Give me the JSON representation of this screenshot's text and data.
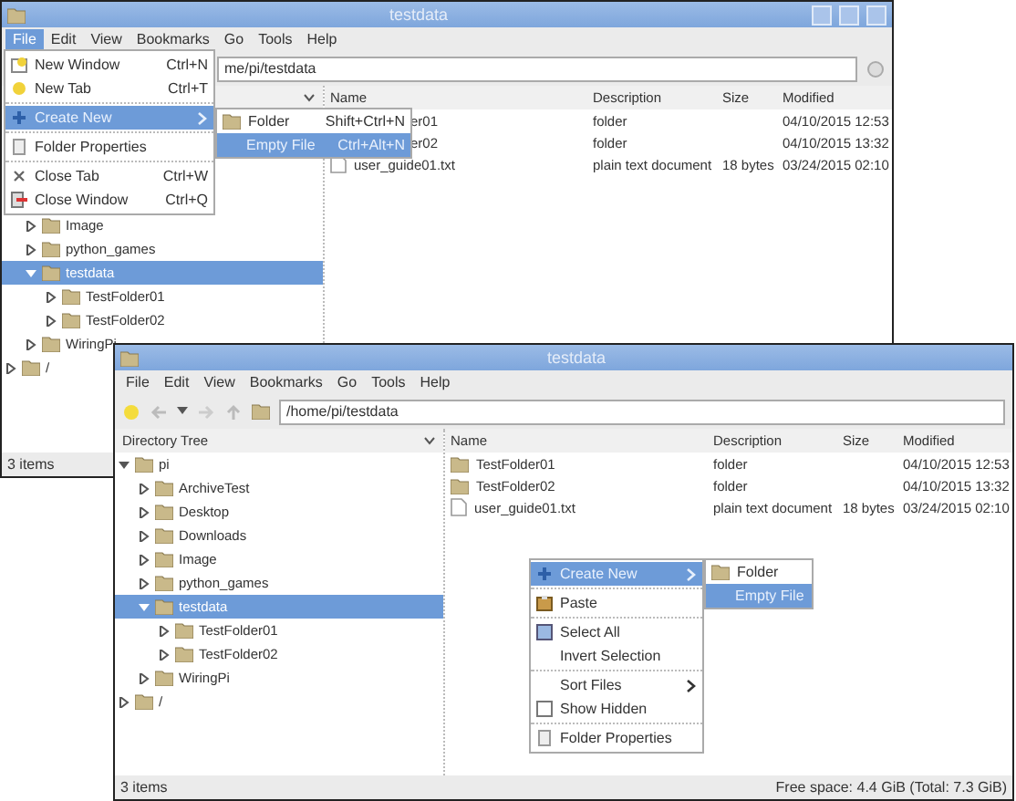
{
  "windows": [
    {
      "title": "testdata",
      "menu_bar": [
        {
          "label": "File",
          "selected": true
        },
        {
          "label": "Edit",
          "selected": false
        },
        {
          "label": "View",
          "selected": false
        },
        {
          "label": "Bookmarks",
          "selected": false
        },
        {
          "label": "Go",
          "selected": false
        },
        {
          "label": "Tools",
          "selected": false
        },
        {
          "label": "Help",
          "selected": false
        }
      ],
      "path": "me/pi/testdata",
      "tree": [
        {
          "children": [
            {
              "label": "Image",
              "expanded": false,
              "selected": false
            },
            {
              "label": "python_games",
              "expanded": false,
              "selected": false
            },
            {
              "label": "testdata",
              "expanded": true,
              "selected": true,
              "children": [
                {
                  "label": "TestFolder01",
                  "expanded": false,
                  "selected": false
                },
                {
                  "label": "TestFolder02",
                  "expanded": false,
                  "selected": false
                }
              ]
            },
            {
              "label": "WiringPi",
              "expanded": false,
              "selected": false
            }
          ]
        },
        {
          "label": "/",
          "expanded": false,
          "selected": false
        }
      ],
      "columns": [
        "Name",
        "Description",
        "Size",
        "Modified"
      ],
      "rows": [
        {
          "name": "er01",
          "description": "folder",
          "modified": "04/10/2015 12:53"
        },
        {
          "name": "er02",
          "description": "folder",
          "modified": "04/10/2015 13:32"
        },
        {
          "kind": "text",
          "name": "user_guide01.txt",
          "description": "plain text document",
          "size": "18 bytes",
          "modified": "03/24/2015 02:10"
        }
      ],
      "status": "3 items",
      "menu": {
        "groups": [
          [
            {
              "kind": "window",
              "label": "New Window",
              "shortcut": "Ctrl+N",
              "selected": false
            },
            {
              "kind": "tab",
              "label": "New Tab",
              "shortcut": "Ctrl+T",
              "selected": false
            }
          ],
          [
            {
              "kind": "create",
              "label": "Create New",
              "submenu": true,
              "selected": true
            }
          ],
          [
            {
              "kind": "properties",
              "label": "Folder Properties",
              "selected": false
            }
          ],
          [
            {
              "kind": "closetab",
              "label": "Close Tab",
              "shortcut": "Ctrl+W",
              "selected": false
            },
            {
              "kind": "closewindow",
              "label": "Close Window",
              "shortcut": "Ctrl+Q",
              "selected": false
            }
          ]
        ]
      },
      "submenu": {
        "items": [
          {
            "kind": "folder",
            "label": "Folder",
            "shortcut": "Shift+Ctrl+N",
            "selected": false
          },
          {
            "kind": "plain",
            "label": "Empty File",
            "shortcut": "Ctrl+Alt+N",
            "selected": true
          }
        ]
      }
    },
    {
      "title": "testdata",
      "menu_bar": [
        {
          "label": "File",
          "selected": false
        },
        {
          "label": "Edit",
          "selected": false
        },
        {
          "label": "View",
          "selected": false
        },
        {
          "label": "Bookmarks",
          "selected": false
        },
        {
          "label": "Go",
          "selected": false
        },
        {
          "label": "Tools",
          "selected": false
        },
        {
          "label": "Help",
          "selected": false
        }
      ],
      "path": "/home/pi/testdata",
      "tree_header": "Directory Tree",
      "tree": [
        {
          "label": "pi",
          "expanded": true,
          "selected": false,
          "children": [
            {
              "label": "ArchiveTest",
              "expanded": false,
              "selected": false
            },
            {
              "label": "Desktop",
              "expanded": false,
              "selected": false
            },
            {
              "label": "Downloads",
              "expanded": false,
              "selected": false
            },
            {
              "label": "Image",
              "expanded": false,
              "selected": false
            },
            {
              "label": "python_games",
              "expanded": false,
              "selected": false
            },
            {
              "label": "testdata",
              "expanded": true,
              "selected": true,
              "children": [
                {
                  "label": "TestFolder01",
                  "expanded": false,
                  "selected": false
                },
                {
                  "label": "TestFolder02",
                  "expanded": false,
                  "selected": false
                }
              ]
            },
            {
              "label": "WiringPi",
              "expanded": false,
              "selected": false
            }
          ]
        },
        {
          "label": "/",
          "expanded": false,
          "selected": false
        }
      ],
      "columns": [
        "Name",
        "Description",
        "Size",
        "Modified"
      ],
      "rows": [
        {
          "kind": "folder",
          "name": "TestFolder01",
          "description": "folder",
          "modified": "04/10/2015 12:53"
        },
        {
          "kind": "folder",
          "name": "TestFolder02",
          "description": "folder",
          "modified": "04/10/2015 13:32"
        },
        {
          "kind": "text",
          "name": "user_guide01.txt",
          "description": "plain text document",
          "size": "18 bytes",
          "modified": "03/24/2015 02:10"
        }
      ],
      "status": "3 items",
      "free_space": "Free space: 4.4 GiB (Total: 7.3 GiB)",
      "menu": {
        "groups": [
          [
            {
              "kind": "create",
              "label": "Create New",
              "submenu": true,
              "selected": true
            }
          ],
          [
            {
              "kind": "paste",
              "label": "Paste",
              "selected": false
            }
          ],
          [
            {
              "kind": "selectall",
              "label": "Select All",
              "selected": false
            },
            {
              "kind": "plain",
              "label": "Invert Selection",
              "selected": false
            }
          ],
          [
            {
              "kind": "plain",
              "label": "Sort Files",
              "submenu": true,
              "selected": false
            },
            {
              "kind": "checkbox",
              "label": "Show Hidden",
              "checked": false,
              "selected": false
            }
          ],
          [
            {
              "kind": "properties",
              "label": "Folder Properties",
              "selected": false
            }
          ]
        ]
      },
      "submenu": {
        "items": [
          {
            "kind": "folder",
            "label": "Folder",
            "selected": false
          },
          {
            "kind": "plain",
            "label": "Empty File",
            "selected": true
          }
        ]
      }
    }
  ]
}
